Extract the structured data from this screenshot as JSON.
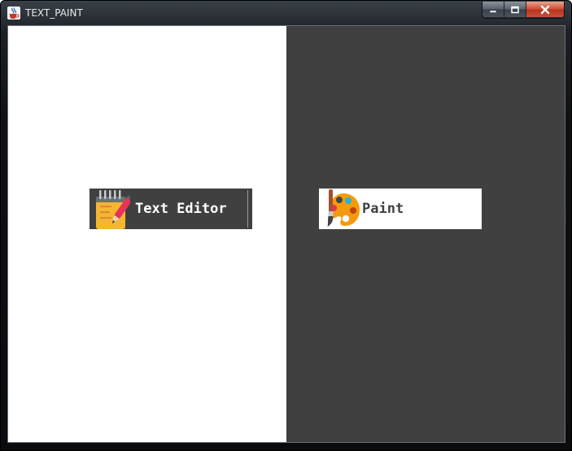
{
  "window": {
    "title": "TEXT_PAINT",
    "app_icon": "java-cup-icon",
    "controls": [
      "minimize-icon",
      "maximize-icon",
      "close-icon"
    ]
  },
  "left_pane": {
    "background": "#ffffff",
    "button": {
      "label": "Text Editor",
      "icon": "notepad-pencil-icon",
      "background": "#404040",
      "text_color": "#ffffff"
    }
  },
  "right_pane": {
    "background": "#404040",
    "button": {
      "label": "Paint",
      "icon": "paint-palette-icon",
      "background": "#ffffff",
      "text_color": "#404040"
    }
  }
}
